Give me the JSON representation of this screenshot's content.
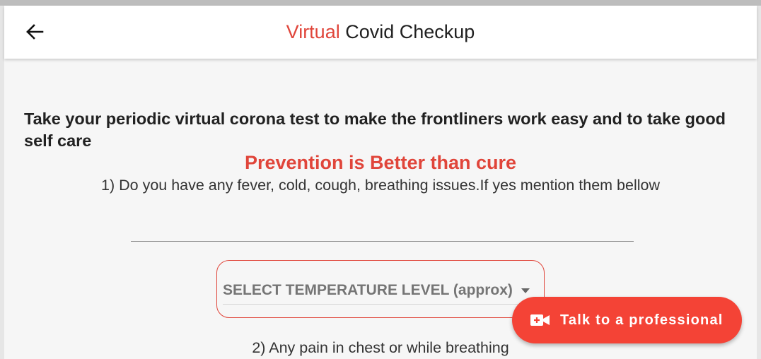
{
  "appbar": {
    "title_accent": "Virtual",
    "title_rest": " Covid Checkup",
    "back_icon": "arrow-left-icon"
  },
  "main": {
    "intro": "Take your periodic virtual corona test to make the frontliners work easy and to take good self care",
    "motto": "Prevention is Better than cure",
    "question1": "1) Do you have any fever, cold, cough, breathing issues.If yes mention them bellow",
    "answer1": {
      "value": "",
      "placeholder": ""
    },
    "temperature_select": {
      "label": "SELECT TEMPERATURE LEVEL (approx)",
      "icon": "caret-down-icon"
    },
    "question2": "2) Any pain in chest or while breathing"
  },
  "fab": {
    "label": "Talk to a professional",
    "icon": "video-camera-icon"
  },
  "colors": {
    "accent": "#e0453a",
    "fab": "#f44336",
    "background": "#f6f6f6"
  }
}
